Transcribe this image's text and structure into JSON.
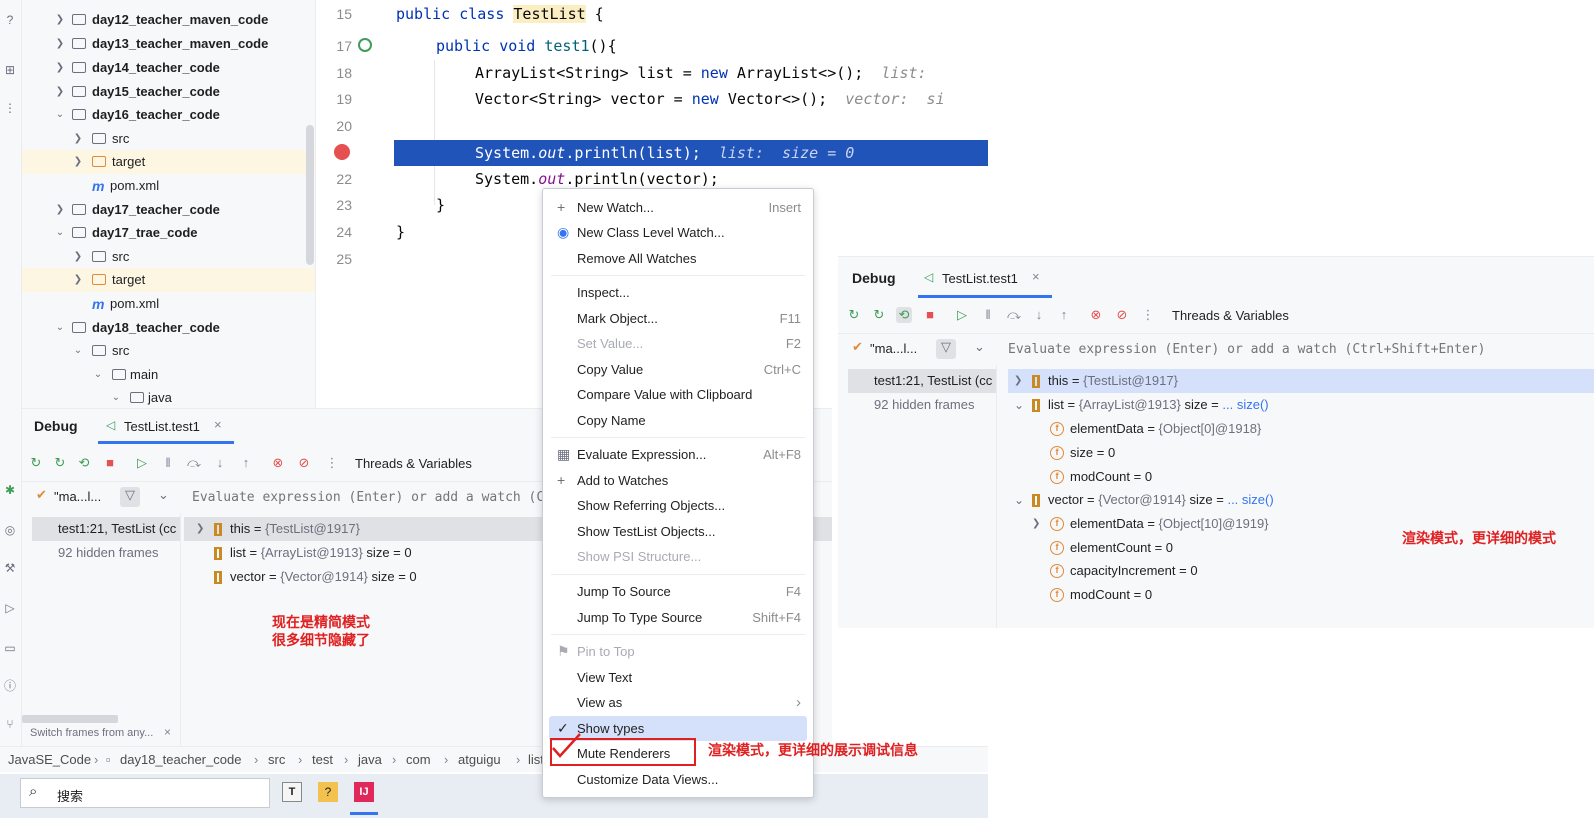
{
  "left_strip": {
    "icons": [
      "help-icon",
      "structure-icon",
      "more-icon",
      "debug-icon",
      "services-icon",
      "build-icon",
      "run-icon",
      "terminal-icon",
      "problems-icon",
      "git-icon"
    ]
  },
  "project_tree": {
    "rows": [
      {
        "label": "day12_teacher_maven_code",
        "type": "module",
        "expanded": false
      },
      {
        "label": "day13_teacher_maven_code",
        "type": "module",
        "expanded": false
      },
      {
        "label": "day14_teacher_code",
        "type": "module",
        "expanded": false
      },
      {
        "label": "day15_teacher_code",
        "type": "module",
        "expanded": false
      },
      {
        "label": "day16_teacher_code",
        "type": "module",
        "expanded": true
      },
      {
        "label": "src",
        "type": "folder",
        "expanded": false
      },
      {
        "label": "target",
        "type": "folder-excluded",
        "expanded": false
      },
      {
        "label": "pom.xml",
        "type": "maven"
      },
      {
        "label": "day17_teacher_code",
        "type": "module",
        "expanded": false
      },
      {
        "label": "day17_trae_code",
        "type": "module",
        "expanded": true
      },
      {
        "label": "src",
        "type": "folder",
        "expanded": false
      },
      {
        "label": "target",
        "type": "folder-excluded",
        "expanded": false
      },
      {
        "label": "pom.xml",
        "type": "maven"
      },
      {
        "label": "day18_teacher_code",
        "type": "module",
        "expanded": true
      },
      {
        "label": "src",
        "type": "folder",
        "expanded": true
      },
      {
        "label": "main",
        "type": "folder",
        "expanded": true
      },
      {
        "label": "java",
        "type": "folder",
        "expanded": true
      }
    ]
  },
  "editor": {
    "line_numbers": [
      "15",
      "17",
      "18",
      "19",
      "20",
      "21",
      "22",
      "23",
      "24",
      "25"
    ],
    "l15": {
      "kw": "public class ",
      "cls": "TestList",
      "rest": " {"
    },
    "l17": {
      "kw": "public void ",
      "fn": "test1",
      "rest": "(){"
    },
    "l18": {
      "code": "ArrayList<String> list = ",
      "kw": "new",
      "rest": " ArrayList<>();",
      "hint": "list: "
    },
    "l19": {
      "code": "Vector<String> vector = ",
      "kw": "new",
      "rest": " Vector<>();",
      "hint": "vector:  si"
    },
    "l21": {
      "pre": "System.",
      "fld": "out",
      "post": ".println(list);",
      "hint": "list:  size = 0"
    },
    "l22": {
      "pre": "System.",
      "fld": "out",
      "post": ".println(vector);"
    },
    "l23": "}",
    "l24": "}"
  },
  "debug_left": {
    "title": "Debug",
    "tab": "TestList.test1",
    "threads_label": "Threads & Variables",
    "thread_selector": "\"ma...l...",
    "eval_placeholder": "Evaluate expression (Enter) or add a watch (C",
    "frames": [
      "test1:21, TestList (cc",
      "92 hidden frames"
    ],
    "vars": [
      {
        "name": "this",
        "eq": " = ",
        "val": "{TestList@1917}",
        "extra": ""
      },
      {
        "name": "list",
        "eq": " = ",
        "val": "{ArrayList@1913}",
        "extra": "  size = 0"
      },
      {
        "name": "vector",
        "eq": " = ",
        "val": "{Vector@1914}",
        "extra": "  size = 0"
      }
    ],
    "annotation_line1": "现在是精简模式",
    "annotation_line2": "很多细节隐藏了",
    "switch_frames": "Switch frames from any..."
  },
  "debug_right": {
    "title": "Debug",
    "tab": "TestList.test1",
    "threads_label": "Threads & Variables",
    "thread_selector": "\"ma...l...",
    "eval_placeholder": "Evaluate expression (Enter) or add a watch (Ctrl+Shift+Enter)",
    "frames": [
      "test1:21, TestList (cc",
      "92 hidden frames"
    ],
    "vars": [
      {
        "name": "this",
        "val": "{TestList@1917}"
      },
      {
        "name": "list",
        "val": "{ArrayList@1913}",
        "size": "size = ",
        "link": "... size()"
      },
      {
        "name": "elementData",
        "val": "{Object[0]@1918}"
      },
      {
        "name": "size",
        "val": "0"
      },
      {
        "name": "modCount",
        "val": "0"
      },
      {
        "name": "vector",
        "val": "{Vector@1914}",
        "size": "size = ",
        "link": "... size()"
      },
      {
        "name": "elementData",
        "val": "{Object[10]@1919}"
      },
      {
        "name": "elementCount",
        "val": "0"
      },
      {
        "name": "capacityIncrement",
        "val": "0"
      },
      {
        "name": "modCount",
        "val": "0"
      }
    ],
    "annotation": "渲染模式，更详细的模式"
  },
  "context_menu": {
    "items": [
      {
        "label": "New Watch...",
        "shortcut": "Insert"
      },
      {
        "label": "New Class Level Watch...",
        "shortcut": ""
      },
      {
        "label": "Remove All Watches",
        "shortcut": ""
      },
      {
        "label": "Inspect...",
        "shortcut": ""
      },
      {
        "label": "Mark Object...",
        "shortcut": "F11"
      },
      {
        "label": "Set Value...",
        "shortcut": "F2"
      },
      {
        "label": "Copy Value",
        "shortcut": "Ctrl+C"
      },
      {
        "label": "Compare Value with Clipboard",
        "shortcut": ""
      },
      {
        "label": "Copy Name",
        "shortcut": ""
      },
      {
        "label": "Evaluate Expression...",
        "shortcut": "Alt+F8"
      },
      {
        "label": "Add to Watches",
        "shortcut": ""
      },
      {
        "label": "Show Referring Objects...",
        "shortcut": ""
      },
      {
        "label": "Show TestList Objects...",
        "shortcut": ""
      },
      {
        "label": "Show PSI Structure...",
        "shortcut": ""
      },
      {
        "label": "Jump To Source",
        "shortcut": "F4"
      },
      {
        "label": "Jump To Type Source",
        "shortcut": "Shift+F4"
      },
      {
        "label": "Pin to Top",
        "shortcut": ""
      },
      {
        "label": "View Text",
        "shortcut": ""
      },
      {
        "label": "View as",
        "shortcut": "›"
      },
      {
        "label": "Show types",
        "shortcut": ""
      },
      {
        "label": "Mute Renderers",
        "shortcut": ""
      },
      {
        "label": "Customize Data Views...",
        "shortcut": ""
      }
    ],
    "mute_annotation": "渲染模式，更详细的展示调试信息"
  },
  "status_bar": {
    "crumbs": [
      "JavaSE_Code",
      "day18_teacher_code",
      "src",
      "test",
      "java",
      "com",
      "atguigu",
      "list"
    ]
  },
  "taskbar": {
    "search_label": "搜索"
  },
  "colors": {
    "accent": "#3574f0",
    "annotation": "#e02020",
    "exec_line": "#2154b9"
  }
}
